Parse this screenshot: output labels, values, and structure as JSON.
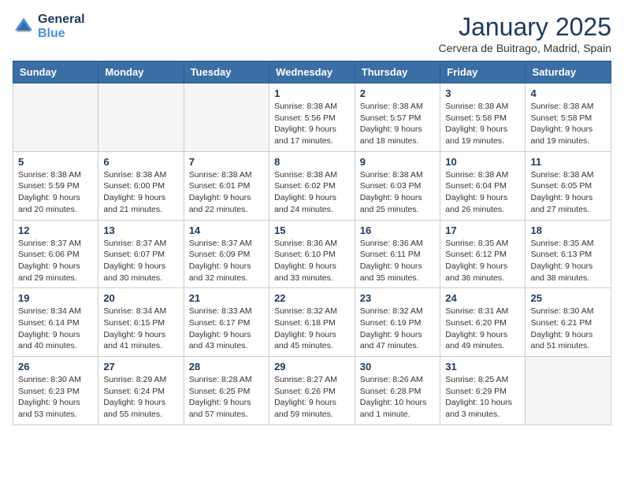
{
  "header": {
    "logo_line1": "General",
    "logo_line2": "Blue",
    "month": "January 2025",
    "location": "Cervera de Buitrago, Madrid, Spain"
  },
  "weekdays": [
    "Sunday",
    "Monday",
    "Tuesday",
    "Wednesday",
    "Thursday",
    "Friday",
    "Saturday"
  ],
  "weeks": [
    [
      {
        "day": "",
        "info": ""
      },
      {
        "day": "",
        "info": ""
      },
      {
        "day": "",
        "info": ""
      },
      {
        "day": "1",
        "info": "Sunrise: 8:38 AM\nSunset: 5:56 PM\nDaylight: 9 hours\nand 17 minutes."
      },
      {
        "day": "2",
        "info": "Sunrise: 8:38 AM\nSunset: 5:57 PM\nDaylight: 9 hours\nand 18 minutes."
      },
      {
        "day": "3",
        "info": "Sunrise: 8:38 AM\nSunset: 5:58 PM\nDaylight: 9 hours\nand 19 minutes."
      },
      {
        "day": "4",
        "info": "Sunrise: 8:38 AM\nSunset: 5:58 PM\nDaylight: 9 hours\nand 19 minutes."
      }
    ],
    [
      {
        "day": "5",
        "info": "Sunrise: 8:38 AM\nSunset: 5:59 PM\nDaylight: 9 hours\nand 20 minutes."
      },
      {
        "day": "6",
        "info": "Sunrise: 8:38 AM\nSunset: 6:00 PM\nDaylight: 9 hours\nand 21 minutes."
      },
      {
        "day": "7",
        "info": "Sunrise: 8:38 AM\nSunset: 6:01 PM\nDaylight: 9 hours\nand 22 minutes."
      },
      {
        "day": "8",
        "info": "Sunrise: 8:38 AM\nSunset: 6:02 PM\nDaylight: 9 hours\nand 24 minutes."
      },
      {
        "day": "9",
        "info": "Sunrise: 8:38 AM\nSunset: 6:03 PM\nDaylight: 9 hours\nand 25 minutes."
      },
      {
        "day": "10",
        "info": "Sunrise: 8:38 AM\nSunset: 6:04 PM\nDaylight: 9 hours\nand 26 minutes."
      },
      {
        "day": "11",
        "info": "Sunrise: 8:38 AM\nSunset: 6:05 PM\nDaylight: 9 hours\nand 27 minutes."
      }
    ],
    [
      {
        "day": "12",
        "info": "Sunrise: 8:37 AM\nSunset: 6:06 PM\nDaylight: 9 hours\nand 29 minutes."
      },
      {
        "day": "13",
        "info": "Sunrise: 8:37 AM\nSunset: 6:07 PM\nDaylight: 9 hours\nand 30 minutes."
      },
      {
        "day": "14",
        "info": "Sunrise: 8:37 AM\nSunset: 6:09 PM\nDaylight: 9 hours\nand 32 minutes."
      },
      {
        "day": "15",
        "info": "Sunrise: 8:36 AM\nSunset: 6:10 PM\nDaylight: 9 hours\nand 33 minutes."
      },
      {
        "day": "16",
        "info": "Sunrise: 8:36 AM\nSunset: 6:11 PM\nDaylight: 9 hours\nand 35 minutes."
      },
      {
        "day": "17",
        "info": "Sunrise: 8:35 AM\nSunset: 6:12 PM\nDaylight: 9 hours\nand 36 minutes."
      },
      {
        "day": "18",
        "info": "Sunrise: 8:35 AM\nSunset: 6:13 PM\nDaylight: 9 hours\nand 38 minutes."
      }
    ],
    [
      {
        "day": "19",
        "info": "Sunrise: 8:34 AM\nSunset: 6:14 PM\nDaylight: 9 hours\nand 40 minutes."
      },
      {
        "day": "20",
        "info": "Sunrise: 8:34 AM\nSunset: 6:15 PM\nDaylight: 9 hours\nand 41 minutes."
      },
      {
        "day": "21",
        "info": "Sunrise: 8:33 AM\nSunset: 6:17 PM\nDaylight: 9 hours\nand 43 minutes."
      },
      {
        "day": "22",
        "info": "Sunrise: 8:32 AM\nSunset: 6:18 PM\nDaylight: 9 hours\nand 45 minutes."
      },
      {
        "day": "23",
        "info": "Sunrise: 8:32 AM\nSunset: 6:19 PM\nDaylight: 9 hours\nand 47 minutes."
      },
      {
        "day": "24",
        "info": "Sunrise: 8:31 AM\nSunset: 6:20 PM\nDaylight: 9 hours\nand 49 minutes."
      },
      {
        "day": "25",
        "info": "Sunrise: 8:30 AM\nSunset: 6:21 PM\nDaylight: 9 hours\nand 51 minutes."
      }
    ],
    [
      {
        "day": "26",
        "info": "Sunrise: 8:30 AM\nSunset: 6:23 PM\nDaylight: 9 hours\nand 53 minutes."
      },
      {
        "day": "27",
        "info": "Sunrise: 8:29 AM\nSunset: 6:24 PM\nDaylight: 9 hours\nand 55 minutes."
      },
      {
        "day": "28",
        "info": "Sunrise: 8:28 AM\nSunset: 6:25 PM\nDaylight: 9 hours\nand 57 minutes."
      },
      {
        "day": "29",
        "info": "Sunrise: 8:27 AM\nSunset: 6:26 PM\nDaylight: 9 hours\nand 59 minutes."
      },
      {
        "day": "30",
        "info": "Sunrise: 8:26 AM\nSunset: 6:28 PM\nDaylight: 10 hours\nand 1 minute."
      },
      {
        "day": "31",
        "info": "Sunrise: 8:25 AM\nSunset: 6:29 PM\nDaylight: 10 hours\nand 3 minutes."
      },
      {
        "day": "",
        "info": ""
      }
    ]
  ]
}
